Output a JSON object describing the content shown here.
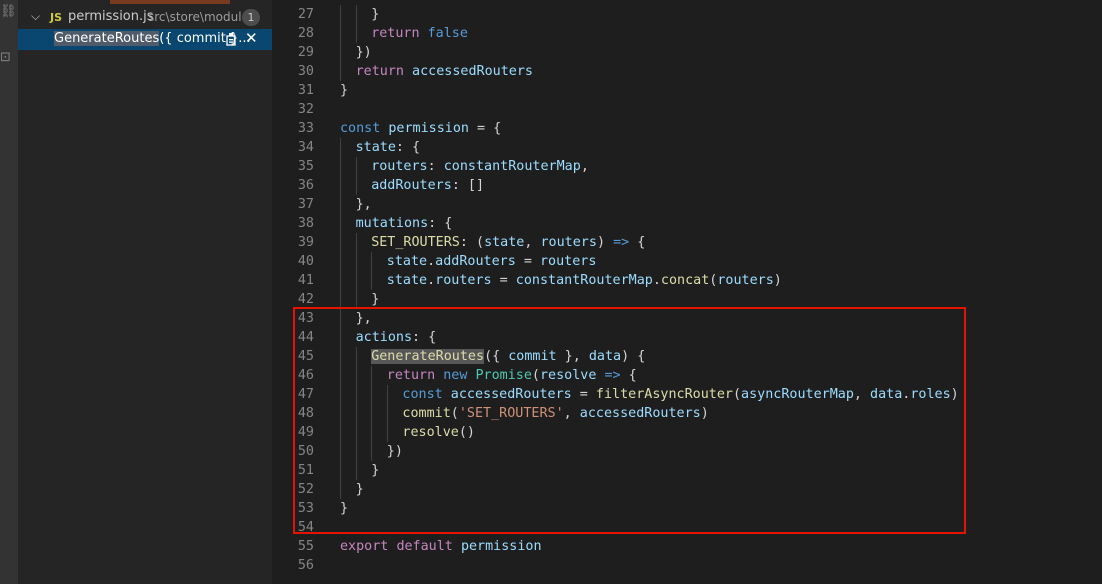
{
  "activity_bar": {
    "glyphs": [
      {
        "icon": "debug-icon",
        "char": "⛓"
      },
      {
        "icon": "extensions-icon",
        "char": "⊡"
      }
    ]
  },
  "sidebar": {
    "file": {
      "name": "permission.js",
      "path": "src\\store\\modules",
      "badge": "1"
    },
    "result": {
      "highlight": "GenerateRoutes",
      "rest": "({ commit }...",
      "replace_icon": "replace-icon",
      "close_icon": "close-icon"
    }
  },
  "editor": {
    "lines": [
      {
        "n": "27",
        "indent": 2,
        "t": [
          [
            "p",
            "}"
          ]
        ]
      },
      {
        "n": "28",
        "indent": 2,
        "t": [
          [
            "kc",
            "return"
          ],
          [
            "p",
            " "
          ],
          [
            "k",
            "false"
          ]
        ]
      },
      {
        "n": "29",
        "indent": 1,
        "t": [
          [
            "p",
            "})"
          ]
        ]
      },
      {
        "n": "30",
        "indent": 1,
        "t": [
          [
            "kc",
            "return"
          ],
          [
            "p",
            " "
          ],
          [
            "v",
            "accessedRouters"
          ]
        ]
      },
      {
        "n": "31",
        "indent": 0,
        "t": [
          [
            "p",
            "}"
          ]
        ]
      },
      {
        "n": "32",
        "indent": 0,
        "t": []
      },
      {
        "n": "33",
        "indent": 0,
        "t": [
          [
            "k",
            "const"
          ],
          [
            "p",
            " "
          ],
          [
            "v",
            "permission"
          ],
          [
            "p",
            " = {"
          ]
        ]
      },
      {
        "n": "34",
        "indent": 1,
        "t": [
          [
            "v",
            "state"
          ],
          [
            "p",
            ": {"
          ]
        ]
      },
      {
        "n": "35",
        "indent": 2,
        "t": [
          [
            "v",
            "routers"
          ],
          [
            "p",
            ": "
          ],
          [
            "v",
            "constantRouterMap"
          ],
          [
            "p",
            ","
          ]
        ]
      },
      {
        "n": "36",
        "indent": 2,
        "t": [
          [
            "v",
            "addRouters"
          ],
          [
            "p",
            ": []"
          ]
        ]
      },
      {
        "n": "37",
        "indent": 1,
        "t": [
          [
            "p",
            "},"
          ]
        ]
      },
      {
        "n": "38",
        "indent": 1,
        "t": [
          [
            "v",
            "mutations"
          ],
          [
            "p",
            ": {"
          ]
        ]
      },
      {
        "n": "39",
        "indent": 2,
        "t": [
          [
            "f",
            "SET_ROUTERS"
          ],
          [
            "p",
            ": ("
          ],
          [
            "v",
            "state"
          ],
          [
            "p",
            ", "
          ],
          [
            "v",
            "routers"
          ],
          [
            "p",
            ") "
          ],
          [
            "k",
            "=>"
          ],
          [
            "p",
            " {"
          ]
        ]
      },
      {
        "n": "40",
        "indent": 3,
        "t": [
          [
            "v",
            "state"
          ],
          [
            "p",
            "."
          ],
          [
            "v",
            "addRouters"
          ],
          [
            "p",
            " = "
          ],
          [
            "v",
            "routers"
          ]
        ]
      },
      {
        "n": "41",
        "indent": 3,
        "t": [
          [
            "v",
            "state"
          ],
          [
            "p",
            "."
          ],
          [
            "v",
            "routers"
          ],
          [
            "p",
            " = "
          ],
          [
            "v",
            "constantRouterMap"
          ],
          [
            "p",
            "."
          ],
          [
            "f",
            "concat"
          ],
          [
            "p",
            "("
          ],
          [
            "v",
            "routers"
          ],
          [
            "p",
            ")"
          ]
        ]
      },
      {
        "n": "42",
        "indent": 2,
        "t": [
          [
            "p",
            "}"
          ]
        ]
      },
      {
        "n": "43",
        "indent": 1,
        "t": [
          [
            "p",
            "},"
          ]
        ]
      },
      {
        "n": "44",
        "indent": 1,
        "t": [
          [
            "v",
            "actions"
          ],
          [
            "p",
            ": {"
          ]
        ]
      },
      {
        "n": "45",
        "indent": 2,
        "t": [
          [
            "fh",
            "GenerateRoutes"
          ],
          [
            "p",
            "({ "
          ],
          [
            "v",
            "commit"
          ],
          [
            "p",
            " }, "
          ],
          [
            "v",
            "data"
          ],
          [
            "p",
            ") {"
          ]
        ]
      },
      {
        "n": "46",
        "indent": 3,
        "t": [
          [
            "kc",
            "return"
          ],
          [
            "p",
            " "
          ],
          [
            "k",
            "new"
          ],
          [
            "p",
            " "
          ],
          [
            "cls",
            "Promise"
          ],
          [
            "p",
            "("
          ],
          [
            "v",
            "resolve"
          ],
          [
            "p",
            " "
          ],
          [
            "k",
            "=>"
          ],
          [
            "p",
            " {"
          ]
        ]
      },
      {
        "n": "47",
        "indent": 4,
        "t": [
          [
            "k",
            "const"
          ],
          [
            "p",
            " "
          ],
          [
            "v",
            "accessedRouters"
          ],
          [
            "p",
            " = "
          ],
          [
            "f",
            "filterAsyncRouter"
          ],
          [
            "p",
            "("
          ],
          [
            "v",
            "asyncRouterMap"
          ],
          [
            "p",
            ", "
          ],
          [
            "v",
            "data"
          ],
          [
            "p",
            "."
          ],
          [
            "v",
            "roles"
          ],
          [
            "p",
            ")"
          ]
        ]
      },
      {
        "n": "48",
        "indent": 4,
        "t": [
          [
            "f",
            "commit"
          ],
          [
            "p",
            "("
          ],
          [
            "s",
            "'SET_ROUTERS'"
          ],
          [
            "p",
            ", "
          ],
          [
            "v",
            "accessedRouters"
          ],
          [
            "p",
            ")"
          ]
        ]
      },
      {
        "n": "49",
        "indent": 4,
        "t": [
          [
            "f",
            "resolve"
          ],
          [
            "p",
            "()"
          ]
        ]
      },
      {
        "n": "50",
        "indent": 3,
        "t": [
          [
            "p",
            "})"
          ]
        ]
      },
      {
        "n": "51",
        "indent": 2,
        "t": [
          [
            "p",
            "}"
          ]
        ]
      },
      {
        "n": "52",
        "indent": 1,
        "t": [
          [
            "p",
            "}"
          ]
        ]
      },
      {
        "n": "53",
        "indent": 0,
        "t": [
          [
            "p",
            "}"
          ]
        ]
      },
      {
        "n": "54",
        "indent": 0,
        "t": []
      },
      {
        "n": "55",
        "indent": 0,
        "t": [
          [
            "kc",
            "export"
          ],
          [
            "p",
            " "
          ],
          [
            "kc",
            "default"
          ],
          [
            "p",
            " "
          ],
          [
            "v",
            "permission"
          ]
        ]
      },
      {
        "n": "56",
        "indent": 0,
        "t": []
      }
    ]
  }
}
